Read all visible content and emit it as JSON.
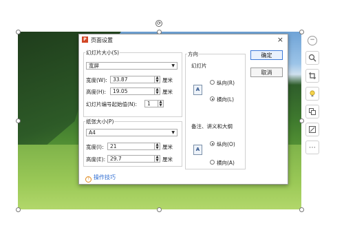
{
  "dialog": {
    "title": "页面设置",
    "close_glyph": "×",
    "app_icon_letter": "P"
  },
  "slide_size": {
    "group_label": "幻灯片大小(S)",
    "selected": "宽屏",
    "width_label": "宽度(W):",
    "width_value": "33.87",
    "height_label": "高度(H):",
    "height_value": "19.05",
    "unit": "厘米",
    "start_num_label": "幻灯片编号起始值(N):",
    "start_num_value": "1"
  },
  "paper_size": {
    "group_label": "纸张大小(P)",
    "selected": "A4",
    "width_label": "宽度(I):",
    "width_value": "21",
    "height_label": "高度(E):",
    "height_value": "29.7",
    "unit": "厘米"
  },
  "orientation": {
    "group_label": "方向",
    "slides_label": "幻灯片",
    "slides_portrait": "纵向(R)",
    "slides_landscape": "横向(L)",
    "slides_selected": "landscape",
    "notes_label": "备注、讲义和大纲",
    "notes_portrait": "纵向(O)",
    "notes_landscape": "横向(A)",
    "notes_selected": "portrait",
    "page_icon_letter": "A"
  },
  "buttons": {
    "ok": "确定",
    "cancel": "取消"
  },
  "tips": {
    "label": "操作技巧"
  },
  "side_tools": {
    "icons": [
      "minus-icon",
      "zoom-icon",
      "crop-icon",
      "bulb-icon",
      "copy-icon",
      "border-icon",
      "more-icon"
    ]
  },
  "colors": {
    "accent": "#3c78d8",
    "link": "#2c6bd1",
    "app_icon": "#d24726"
  }
}
